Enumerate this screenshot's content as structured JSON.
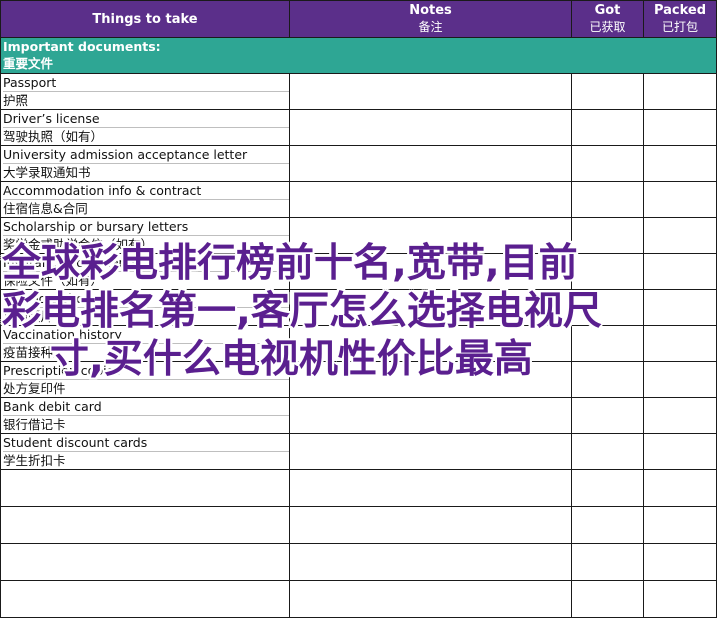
{
  "headers": {
    "things": "Things to take",
    "notes_en": "Notes",
    "notes_cn": "备注",
    "got_en": "Got",
    "got_cn": "已获取",
    "packed_en": "Packed",
    "packed_cn": "已打包"
  },
  "section": {
    "en": "Important documents:",
    "cn": "重要文件"
  },
  "items": [
    {
      "en": "Passport",
      "cn": "护照"
    },
    {
      "en": "Driver’s license",
      "cn": "驾驶执照（如有）"
    },
    {
      "en": "University admission acceptance letter",
      "cn": "大学录取通知书"
    },
    {
      "en": "Accommodation info & contract",
      "cn": "住宿信息&合同"
    },
    {
      "en": "Scholarship or bursary letters",
      "cn": "奖学金或助学金信（如有）"
    },
    {
      "en": "Insurance documents",
      "cn": "保险文件（如有）"
    },
    {
      "en": "Passport photos",
      "cn": "护照照片"
    },
    {
      "en": "Vaccination history",
      "cn": "疫苗接种史"
    },
    {
      "en": "Prescription copies",
      "cn": "处方复印件"
    },
    {
      "en": "Bank debit card",
      "cn": "银行借记卡"
    },
    {
      "en": "Student discount cards",
      "cn": "学生折扣卡"
    }
  ],
  "overlay": {
    "line1": "全球彩电排行榜前十名,宽带,目前",
    "line2": "彩电排名第一,客厅怎么选择电视尺",
    "line3": "寸,买什么电视机性价比最高"
  }
}
